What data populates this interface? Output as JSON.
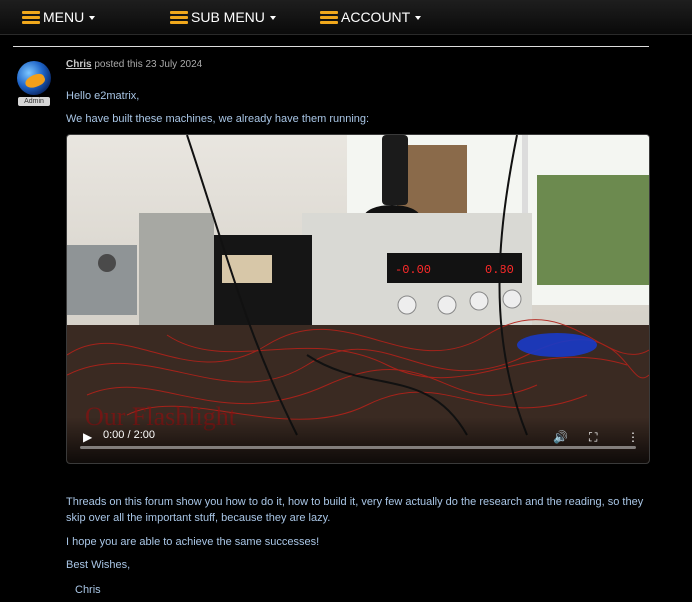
{
  "nav": {
    "items": [
      {
        "label": "MENU"
      },
      {
        "label": "SUB MENU"
      },
      {
        "label": "ACCOUNT"
      }
    ]
  },
  "post": {
    "author": "Chris",
    "meta_text": "posted this 23 July 2024",
    "role_badge": "Admin",
    "greeting": "Hello e2matrix,",
    "intro": "We have built these machines, we already have them running:",
    "video": {
      "time_label": "0:00 / 2:00",
      "progress": 0,
      "overlay_text": "Our Flashlight",
      "display_left": "-0.00",
      "display_right": "0.80"
    },
    "paragraph_1": "Threads on this forum show you how to do it, how to build it, very few actually do the research and the reading, so they skip over all the important stuff, because they are lazy.",
    "paragraph_2": "I hope you are able to achieve the same successes!",
    "closing": "Best Wishes,",
    "signature": "Chris"
  },
  "colors": {
    "accent_burger": "#f0a81c",
    "link_blue": "#a9c6e6",
    "background": "#000000"
  }
}
